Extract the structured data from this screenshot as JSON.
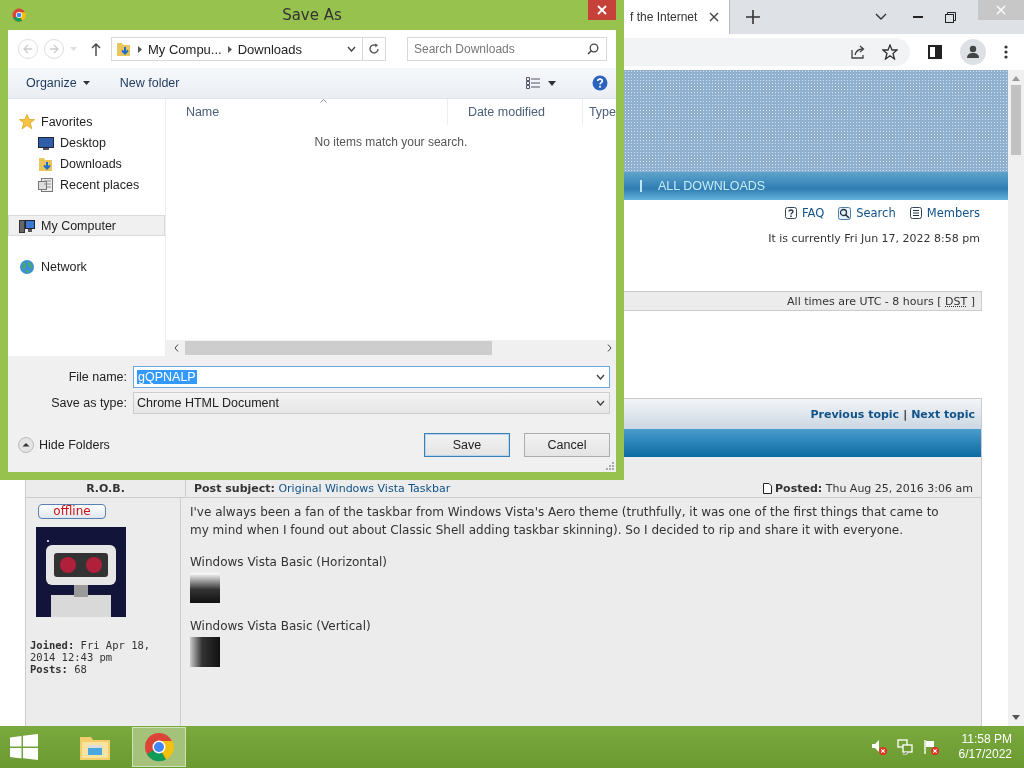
{
  "browser": {
    "tabs": [
      {
        "title": "f the Internet"
      }
    ]
  },
  "page": {
    "nav_items": [
      {
        "label": "ALL DOWNLOADS"
      }
    ],
    "quick_links": [
      {
        "label": "FAQ"
      },
      {
        "label": "Search"
      },
      {
        "label": "Members"
      }
    ],
    "current_time": "It is currently Fri Jun 17, 2022 8:58 pm",
    "timezone": {
      "text": "All times are UTC - 8 hours [",
      "abbr": "DST",
      "close": "]"
    },
    "topic_nav": {
      "previous": "Previous topic",
      "separator": "|",
      "next": "Next topic"
    },
    "post": {
      "author": "R.O.B.",
      "status": "offline",
      "subject_label": "Post subject:",
      "subject": "Original Windows Vista Taskbar",
      "posted_label": "Posted:",
      "posted": "Thu Aug 25, 2016 3:06 am",
      "joined_label": "Joined:",
      "joined": "Fri Apr 18, 2014 12:43 pm",
      "posts_label": "Posts:",
      "posts": "68",
      "body": "I've always been a fan of the taskbar from Windows Vista's Aero theme (truthfully, it was one of the first things that came to my mind when I found out about Classic Shell adding taskbar skinning). So I decided to rip and share it with everyone.",
      "attachments": [
        {
          "caption": "Windows Vista Basic (Horizontal)",
          "kind": "horizontal"
        },
        {
          "caption": "Windows Vista Basic (Vertical)",
          "kind": "vertical"
        }
      ]
    }
  },
  "dialog": {
    "title": "Save As",
    "breadcrumb": [
      "My Compu...",
      "Downloads"
    ],
    "search_placeholder": "Search Downloads",
    "toolbar": {
      "organize": "Organize",
      "new_folder": "New folder"
    },
    "navigation": [
      {
        "label": "Favorites",
        "selected": false,
        "children": [
          {
            "label": "Desktop",
            "selected": false
          },
          {
            "label": "Downloads",
            "selected": false
          },
          {
            "label": "Recent places",
            "selected": false
          }
        ]
      },
      {
        "label": "My Computer",
        "selected": true
      },
      {
        "label": "Network",
        "selected": false
      }
    ],
    "columns": [
      {
        "label": "Name",
        "sorted": true
      },
      {
        "label": "Date modified",
        "sorted": false
      },
      {
        "label": "Type",
        "sorted": false
      }
    ],
    "empty_message": "No items match your search.",
    "file_name": {
      "label": "File name:",
      "value": "gQPNALP",
      "text_selected": true
    },
    "save_type": {
      "label": "Save as type:",
      "value": "Chrome HTML Document"
    },
    "hide_folders": "Hide Folders",
    "buttons": [
      {
        "label": "Save",
        "default": true
      },
      {
        "label": "Cancel",
        "default": false
      }
    ]
  },
  "taskbar": {
    "apps": [
      {
        "active": false
      },
      {
        "active": true
      }
    ],
    "time": "11:58 PM",
    "date": "6/17/2022"
  }
}
